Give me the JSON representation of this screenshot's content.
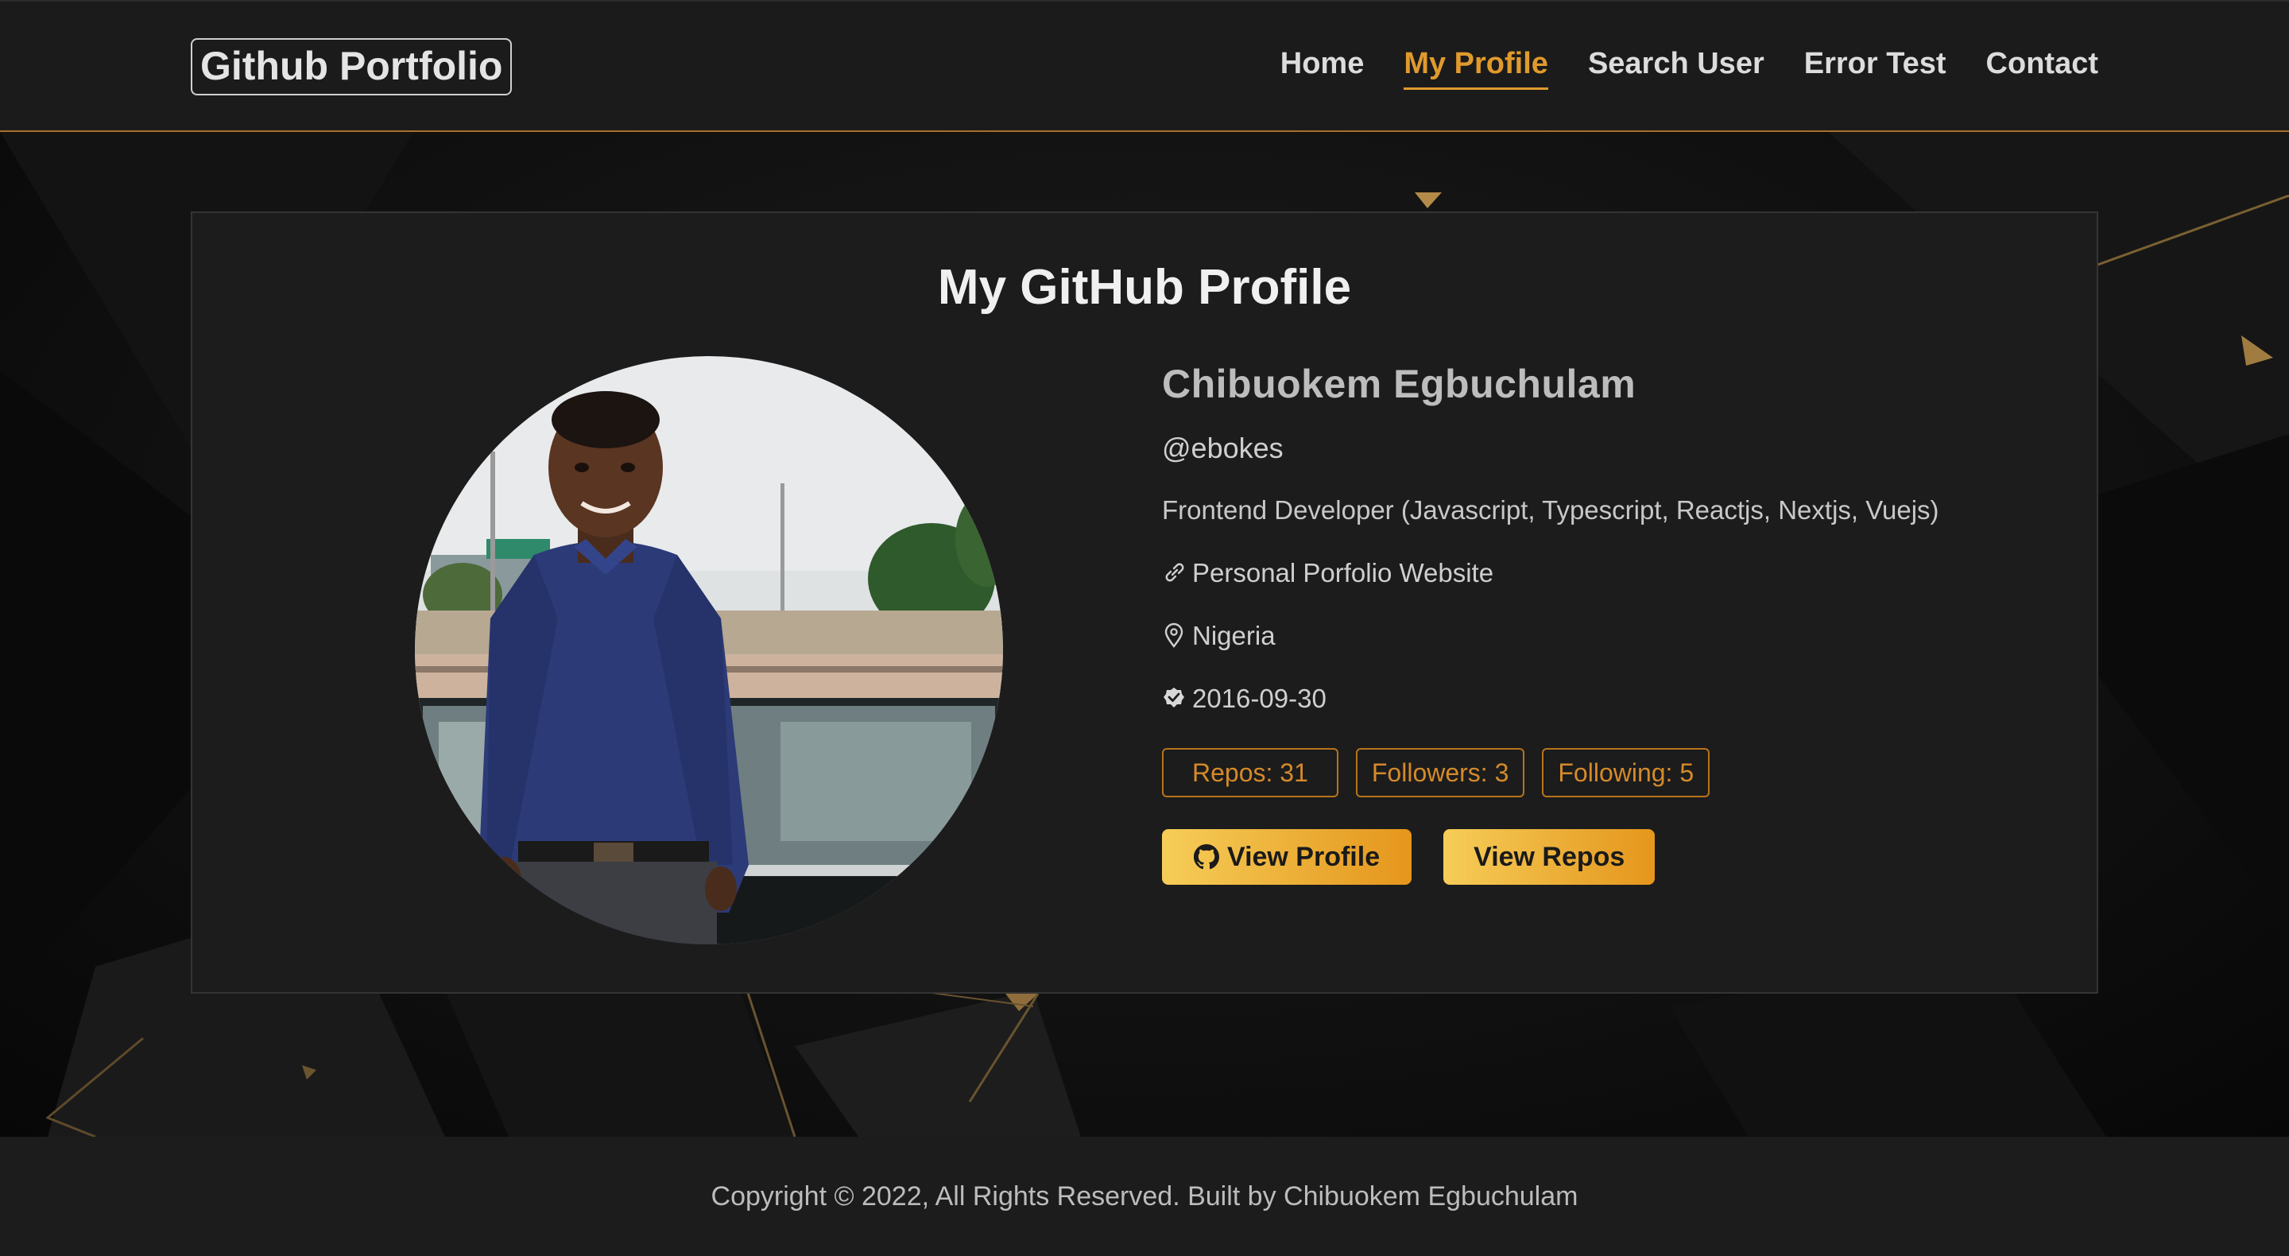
{
  "header": {
    "brand": "Github Portfolio",
    "nav": [
      {
        "label": "Home",
        "active": false
      },
      {
        "label": "My Profile",
        "active": true
      },
      {
        "label": "Search User",
        "active": false
      },
      {
        "label": "Error Test",
        "active": false
      },
      {
        "label": "Contact",
        "active": false
      }
    ]
  },
  "profile": {
    "heading": "My GitHub Profile",
    "name": "Chibuokem Egbuchulam",
    "username": "@ebokes",
    "bio": "Frontend Developer (Javascript, Typescript, Reactjs, Nextjs, Vuejs)",
    "website_label": "Personal Porfolio Website",
    "location": "Nigeria",
    "joined": "2016-09-30",
    "stats": {
      "repos": "Repos: 31",
      "followers": "Followers: 3",
      "following": "Following: 5"
    },
    "buttons": {
      "view_profile": "View Profile",
      "view_repos": "View Repos"
    },
    "icons": {
      "website": "link-icon",
      "location": "map-pin-icon",
      "joined": "verified-check-icon",
      "view_profile": "github-icon"
    }
  },
  "footer": {
    "text": "Copyright © 2022, All Rights Reserved. Built by Chibuokem Egbuchulam"
  },
  "colors": {
    "accent": "#e09a2c",
    "button_gradient_start": "#f6cd58",
    "button_gradient_end": "#e6961c",
    "card_bg": "#1c1c1c",
    "header_bg": "#1b1b1b"
  }
}
